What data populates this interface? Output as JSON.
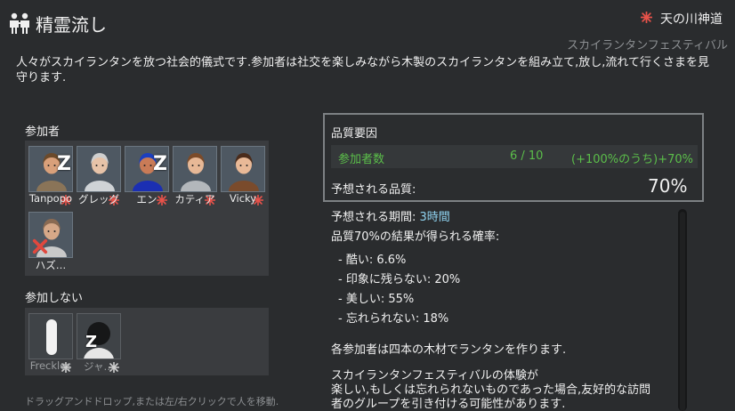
{
  "header": {
    "title": "精霊流し",
    "title_icon": "ritual-people-icon",
    "ideology_icon": "ideology-symbol-icon",
    "ideology_name": "天の川神道",
    "ritual_subtitle": "スカイランタンフェスティバル",
    "description": "人々がスカイランタンを放つ社会的儀式です.参加者は社交を楽しみながら木製のスカイランタンを組み立て,放し,流れて行くさまを見守ります."
  },
  "participants": {
    "label": "参加者",
    "pawns": [
      {
        "name": "Tanpopo",
        "sleeping": true,
        "badge": true,
        "hair": "#6b4a2b",
        "skin": "#d9a07a",
        "shirt": "#8a7458"
      },
      {
        "name": "グレッグ",
        "sleeping": false,
        "badge": true,
        "hair": "#cfcfcf",
        "skin": "#e7c3a8",
        "shirt": "#cfd3d6"
      },
      {
        "name": "エン",
        "sleeping": true,
        "badge": true,
        "hair": "#1c3fbf",
        "skin": "#c97b57",
        "shirt": "#1b2fb3"
      },
      {
        "name": "カティア",
        "sleeping": false,
        "badge": true,
        "hair": "#7b4b2a",
        "skin": "#e7b896",
        "shirt": "#b3b7bb"
      },
      {
        "name": "Vicky",
        "sleeping": false,
        "badge": true,
        "hair": "#4a2c1c",
        "skin": "#e9b997",
        "shirt": "#7a4b2c"
      },
      {
        "name": "ハズ…",
        "sleeping": false,
        "badge": false,
        "hair": "#8a6a52",
        "skin": "#d6a888",
        "shirt": "#c9c9c9"
      }
    ]
  },
  "non_participants": {
    "label": "参加しない",
    "pawns": [
      {
        "name": "Freckles",
        "sleeping": false
      },
      {
        "name": "ジャ…",
        "sleeping": true
      }
    ]
  },
  "hint": "ドラッグアンドドロップ,または左/右クリックで人を移動.",
  "quality": {
    "title": "品質要因",
    "row": {
      "label": "参加者数",
      "count": "6 / 10",
      "effect": "(+100%のうち)+70%"
    },
    "expected_label": "予想される品質:",
    "expected_value": "70%"
  },
  "details": {
    "duration_label": "予想される期間: ",
    "duration_value": "3時間",
    "chance_label": "品質70%の結果が得られる確率:",
    "outcomes": [
      "- 酷い: 6.6%",
      "- 印象に残らない: 20%",
      "- 美しい: 55%",
      "- 忘れられない: 18%"
    ],
    "materials": "各参加者は四本の木材でランタンを作ります.",
    "effect_text_1": "スカイランタンフェスティバルの体験が",
    "effect_text_2": "楽しい,もしくは忘れられないものであった場合,友好的な訪問",
    "effect_text_3": "者のグループを引き付ける可能性があります."
  },
  "colors": {
    "positive": "#5bbe4a",
    "duration": "#8fd3f0",
    "badge": "#e8524a"
  }
}
